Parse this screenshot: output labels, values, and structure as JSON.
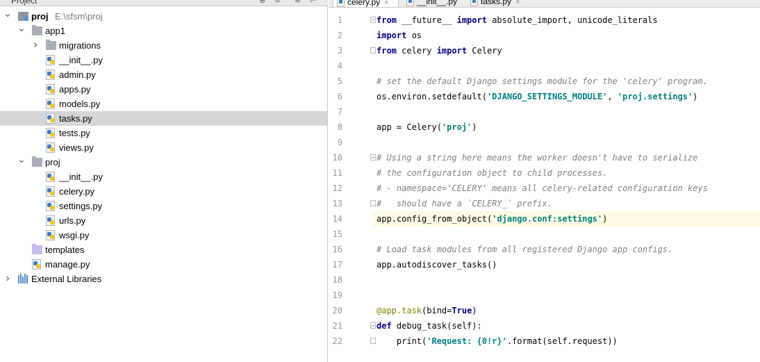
{
  "project_panel": {
    "title": "Project",
    "tree": [
      {
        "label": "proj",
        "path": "E:\\sfsm\\proj",
        "type": "module",
        "depth": 0,
        "expanded": true,
        "bold": true
      },
      {
        "label": "app1",
        "type": "folder",
        "depth": 1,
        "expanded": true
      },
      {
        "label": "migrations",
        "type": "folder",
        "depth": 2,
        "expanded": false
      },
      {
        "label": "__init__.py",
        "type": "py",
        "depth": 2
      },
      {
        "label": "admin.py",
        "type": "py",
        "depth": 2
      },
      {
        "label": "apps.py",
        "type": "py",
        "depth": 2
      },
      {
        "label": "models.py",
        "type": "py",
        "depth": 2
      },
      {
        "label": "tasks.py",
        "type": "py",
        "depth": 2,
        "selected": true
      },
      {
        "label": "tests.py",
        "type": "py",
        "depth": 2
      },
      {
        "label": "views.py",
        "type": "py",
        "depth": 2
      },
      {
        "label": "proj",
        "type": "folder",
        "depth": 1,
        "expanded": true
      },
      {
        "label": "__init__.py",
        "type": "py",
        "depth": 2
      },
      {
        "label": "celery.py",
        "type": "py",
        "depth": 2
      },
      {
        "label": "settings.py",
        "type": "py",
        "depth": 2
      },
      {
        "label": "urls.py",
        "type": "py",
        "depth": 2
      },
      {
        "label": "wsgi.py",
        "type": "py",
        "depth": 2
      },
      {
        "label": "templates",
        "type": "folder-purple",
        "depth": 1
      },
      {
        "label": "manage.py",
        "type": "py",
        "depth": 1
      },
      {
        "label": "External Libraries",
        "type": "lib",
        "depth": 0,
        "expanded": false
      }
    ]
  },
  "editor": {
    "tabs": [
      {
        "label": "celery.py",
        "active": true
      },
      {
        "label": "__init__.py",
        "active": false
      },
      {
        "label": "tasks.py",
        "active": false
      }
    ],
    "current_line": 14,
    "lines": [
      {
        "n": 1,
        "fold": "open",
        "tokens": [
          [
            "kw",
            "from"
          ],
          [
            "",
            " __future__ "
          ],
          [
            "kw",
            "import"
          ],
          [
            "",
            " absolute_import, unicode_literals"
          ]
        ]
      },
      {
        "n": 2,
        "tokens": [
          [
            "kw",
            "import"
          ],
          [
            "",
            " os"
          ]
        ]
      },
      {
        "n": 3,
        "fold": "close",
        "tokens": [
          [
            "kw",
            "from"
          ],
          [
            "",
            " celery "
          ],
          [
            "kw",
            "import"
          ],
          [
            "",
            " Celery"
          ]
        ]
      },
      {
        "n": 4,
        "tokens": []
      },
      {
        "n": 5,
        "tokens": [
          [
            "cmt",
            "# set the default Django settings module for the 'celery' program."
          ]
        ]
      },
      {
        "n": 6,
        "tokens": [
          [
            "",
            "os.environ.setdefault("
          ],
          [
            "str",
            "'DJANGO_SETTINGS_MODULE'"
          ],
          [
            "",
            ", "
          ],
          [
            "str",
            "'proj.settings'"
          ],
          [
            "",
            ")"
          ]
        ]
      },
      {
        "n": 7,
        "tokens": []
      },
      {
        "n": 8,
        "tokens": [
          [
            "",
            "app = Celery("
          ],
          [
            "str",
            "'proj'"
          ],
          [
            "",
            ")"
          ]
        ]
      },
      {
        "n": 9,
        "tokens": []
      },
      {
        "n": 10,
        "fold": "open",
        "tokens": [
          [
            "cmt",
            "# Using a string here means the worker doesn't have to serialize"
          ]
        ]
      },
      {
        "n": 11,
        "tokens": [
          [
            "cmt",
            "# the configuration object to child processes."
          ]
        ]
      },
      {
        "n": 12,
        "tokens": [
          [
            "cmt",
            "# - namespace='CELERY' means all celery-related configuration keys"
          ]
        ]
      },
      {
        "n": 13,
        "fold": "close",
        "tokens": [
          [
            "cmt",
            "#   should have a `CELERY_` prefix."
          ]
        ]
      },
      {
        "n": 14,
        "tokens": [
          [
            "",
            "app.config_from_object("
          ],
          [
            "str",
            "'django.conf:settings'"
          ],
          [
            "",
            ")"
          ]
        ]
      },
      {
        "n": 15,
        "tokens": []
      },
      {
        "n": 16,
        "tokens": [
          [
            "cmt",
            "# Load task modules from all registered Django app configs."
          ]
        ]
      },
      {
        "n": 17,
        "tokens": [
          [
            "",
            "app.autodiscover_tasks()"
          ]
        ]
      },
      {
        "n": 18,
        "tokens": []
      },
      {
        "n": 19,
        "tokens": []
      },
      {
        "n": 20,
        "tokens": [
          [
            "deco",
            "@app.task"
          ],
          [
            "",
            "(bind="
          ],
          [
            "kw",
            "True"
          ],
          [
            "",
            ")"
          ]
        ]
      },
      {
        "n": 21,
        "fold": "open",
        "tokens": [
          [
            "kw",
            "def"
          ],
          [
            "",
            " debug_task(self):"
          ]
        ]
      },
      {
        "n": 22,
        "fold": "close",
        "tokens": [
          [
            "",
            "    print("
          ],
          [
            "str",
            "'Request: {0!r}'"
          ],
          [
            "",
            ".format(self.request))"
          ]
        ]
      }
    ]
  },
  "colors": {
    "selection": "#d6d6d6",
    "current_line": "#fffae3",
    "keyword": "#000080",
    "string": "#008080",
    "comment": "#808080",
    "decorator": "#808000"
  }
}
